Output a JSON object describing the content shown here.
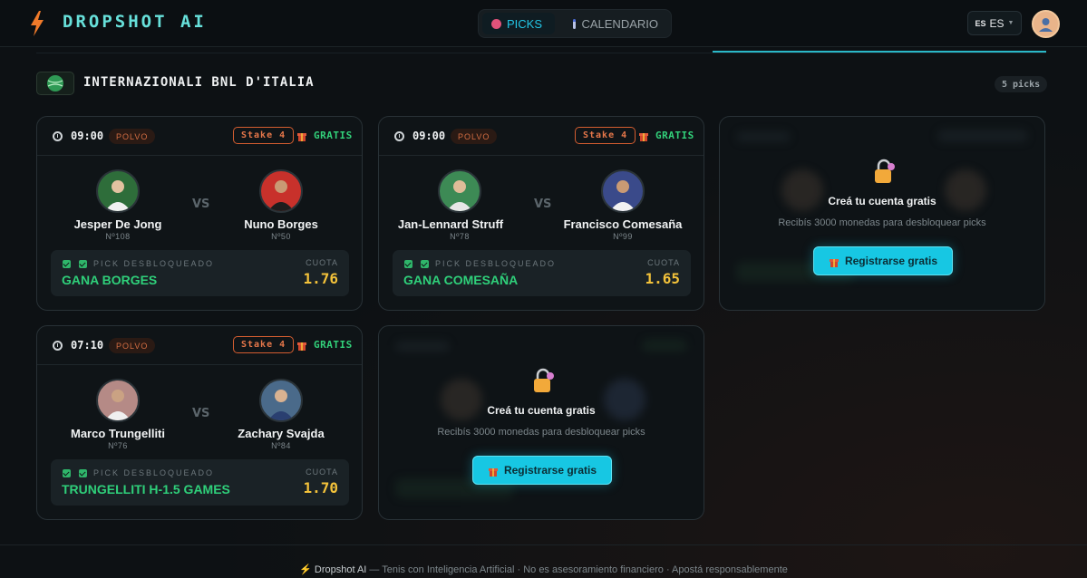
{
  "app": {
    "name": "DROPSHOT AI"
  },
  "nav": {
    "tabs": [
      {
        "label": "PICKS",
        "icon": "target-icon",
        "active": true
      },
      {
        "label": "CALENDARIO",
        "icon": "calendar-icon",
        "active": false
      }
    ]
  },
  "lang": {
    "flag_text": "ES",
    "label": "ES"
  },
  "tournament": {
    "name": "INTERNAZIONALI BNL D'ITALIA",
    "count": "5 picks"
  },
  "matches": [
    {
      "time": "09:00",
      "surface": "POLVO",
      "stake": "Stake 4",
      "free": "GRATIS",
      "p1": {
        "name": "Jesper De Jong",
        "rank": "Nº108"
      },
      "p2": {
        "name": "Nuno Borges",
        "rank": "Nº50"
      },
      "vs": "VS",
      "pick_label": "PICK DESBLOQUEADO",
      "pick": "GANA BORGES",
      "cuota_label": "CUOTA",
      "cuota": "1.76"
    },
    {
      "time": "09:00",
      "surface": "POLVO",
      "stake": "Stake 4",
      "free": "GRATIS",
      "p1": {
        "name": "Jan-Lennard Struff",
        "rank": "Nº78"
      },
      "p2": {
        "name": "Francisco Comesaña",
        "rank": "Nº99"
      },
      "vs": "VS",
      "pick_label": "PICK DESBLOQUEADO",
      "pick": "GANA COMESAÑA",
      "cuota_label": "CUOTA",
      "cuota": "1.65"
    },
    {
      "time": "07:10",
      "surface": "POLVO",
      "stake": "Stake 4",
      "free": "GRATIS",
      "p1": {
        "name": "Marco Trungelliti",
        "rank": "Nº76"
      },
      "p2": {
        "name": "Zachary Svajda",
        "rank": "Nº84"
      },
      "vs": "VS",
      "pick_label": "PICK DESBLOQUEADO",
      "pick": "TRUNGELLITI H-1.5 GAMES",
      "cuota_label": "CUOTA",
      "cuota": "1.70"
    }
  ],
  "locked": {
    "title": "Creá tu cuenta gratis",
    "subtitle": "Recibís 3000 monedas para desbloquear picks",
    "button": "Registrarse gratis"
  },
  "footer": {
    "brand": "Dropshot AI",
    "text": " — Tenis con Inteligencia Artificial · No es asesoramiento financiero · Apostá responsablemente"
  },
  "colors": {
    "accent": "#17c7e3",
    "logo": "#67e0da",
    "win": "#2fd07a",
    "odds": "#f3c23a",
    "stake": "#d35d30"
  }
}
